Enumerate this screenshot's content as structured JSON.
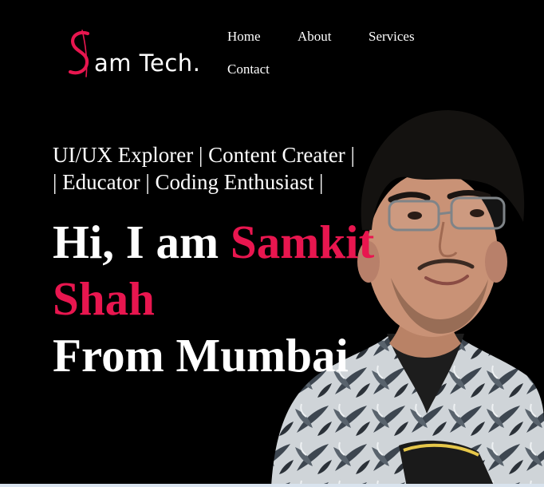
{
  "brand": {
    "mark": "S",
    "name": "am Tech.",
    "accent_color": "#e8164f"
  },
  "nav": {
    "items": [
      {
        "label": "Home"
      },
      {
        "label": "About"
      },
      {
        "label": "Services"
      },
      {
        "label": "Contact"
      }
    ]
  },
  "hero": {
    "tagline_line1": "UI/UX Explorer | Content Creater |",
    "tagline_line2": "| Educator | Coding Enthusiast |",
    "greeting": "Hi, I am ",
    "first_name": "Samkit",
    "last_name": "Shah",
    "location_line": "From Mumbai"
  },
  "photo": {
    "icon": "profile-photo"
  },
  "colors": {
    "background": "#000000",
    "text": "#ffffff",
    "accent": "#e8164f"
  }
}
